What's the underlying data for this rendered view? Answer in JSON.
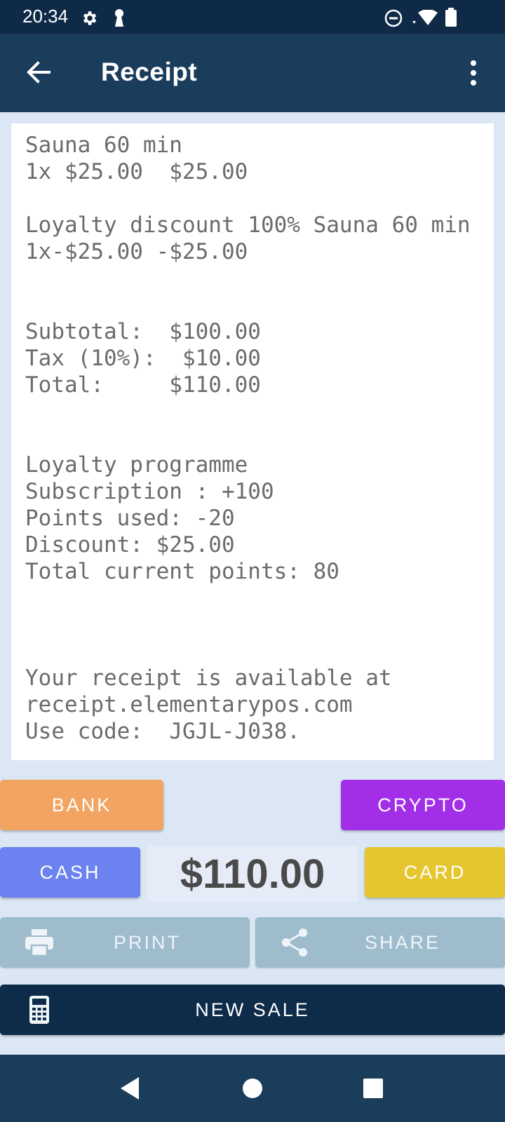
{
  "status_bar": {
    "time": "20:34",
    "icons": [
      "gear-icon",
      "key-icon",
      "do-not-disturb-icon",
      "wifi-icon",
      "battery-icon"
    ]
  },
  "app_bar": {
    "title": "Receipt",
    "back_icon": "arrow-back-icon",
    "menu_icon": "more-vert-icon"
  },
  "receipt": {
    "lines": [
      "Sauna 60 min",
      "1x $25.00  $25.00",
      "",
      "Loyalty discount 100% Sauna 60 min",
      "1x-$25.00 -$25.00",
      "",
      "",
      "Subtotal:  $100.00",
      "Tax (10%):  $10.00",
      "Total:     $110.00",
      "",
      "",
      "Loyalty programme",
      "Subscription : +100",
      "Points used: -20",
      "Discount: $25.00",
      "Total current points: 80",
      "",
      "",
      "",
      "Your receipt is available at",
      "receipt.elementarypos.com",
      "Use code:  JGJL-J038."
    ]
  },
  "payment": {
    "bank_label": "BANK",
    "crypto_label": "CRYPTO",
    "cash_label": "CASH",
    "card_label": "CARD",
    "total": "$110.00"
  },
  "actions": {
    "print_label": "PRINT",
    "share_label": "SHARE",
    "new_sale_label": "NEW SALE",
    "print_icon": "printer-icon",
    "share_icon": "share-icon",
    "new_sale_icon": "calculator-icon"
  },
  "colors": {
    "status_bar": "#0e2a47",
    "app_bar": "#1b3d5c",
    "bank": "#f2a462",
    "crypto": "#a32ee8",
    "cash": "#6b82f0",
    "card": "#e5c62e",
    "secondary_action": "#9fbccd",
    "new_sale": "#0f2b4a"
  },
  "nav_bar": {
    "icons": [
      "nav-back-icon",
      "nav-home-icon",
      "nav-recents-icon"
    ]
  }
}
